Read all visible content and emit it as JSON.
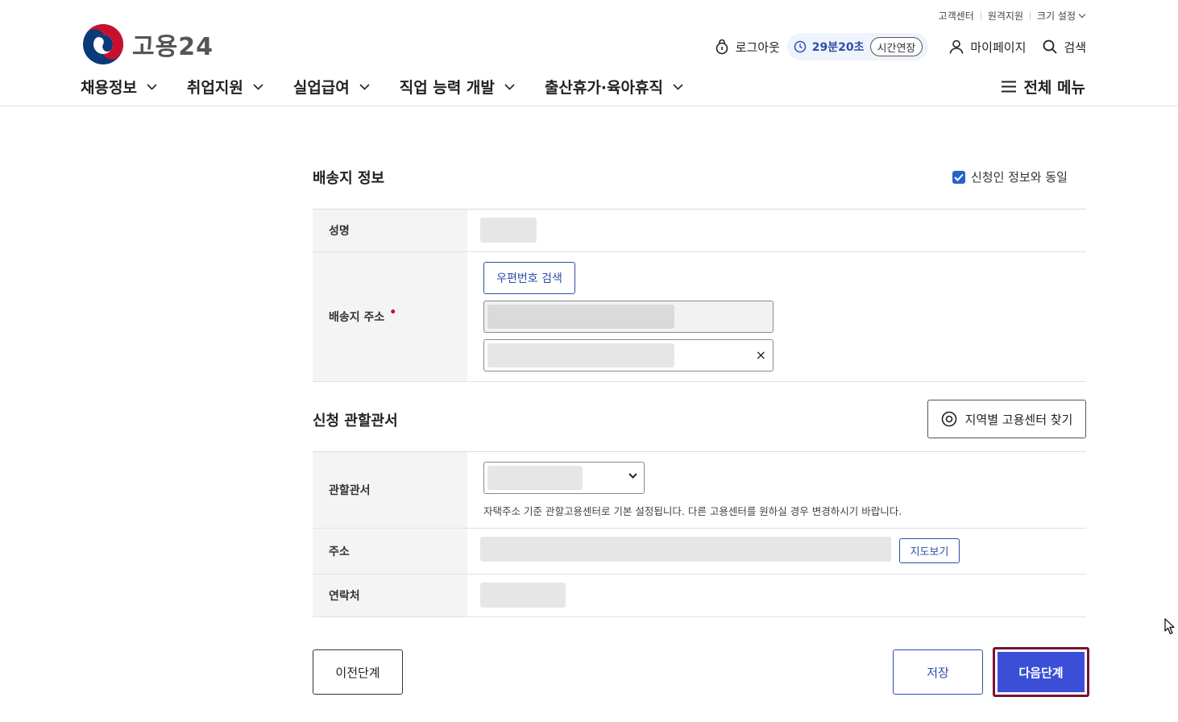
{
  "utility_bar": {
    "items": [
      "고객센터",
      "원격지원",
      "크기 설정"
    ]
  },
  "header": {
    "logo_text": "고용24",
    "logout_label": "로그아웃",
    "timer": "29분20초",
    "extend_label": "시간연장",
    "mypage_label": "마이페이지",
    "search_label": "검색",
    "all_menu_label": "전체 메뉴"
  },
  "nav": {
    "items": [
      {
        "label": "채용정보"
      },
      {
        "label": "취업지원"
      },
      {
        "label": "실업급여"
      },
      {
        "label": "직업 능력 개발"
      },
      {
        "label": "출산휴가·육아휴직"
      }
    ]
  },
  "delivery": {
    "title": "배송지 정보",
    "same_as_applicant_label": "신청인 정보와 동일",
    "same_as_applicant_checked": true,
    "name_label": "성명",
    "address_label": "배송지 주소",
    "required_mark": "•",
    "zip_search_label": "우편번호 검색",
    "clear_icon": "×"
  },
  "office": {
    "title": "신청 관할관서",
    "find_center_label": "지역별 고용센터 찾기",
    "office_label": "관할관서",
    "office_note": "자택주소 기준 관할고용센터로 기본 설정됩니다. 다른 고용센터를 원하실 경우 변경하시기 바랍니다.",
    "address_label": "주소",
    "map_button_label": "지도보기",
    "contact_label": "연락처"
  },
  "footer_buttons": {
    "prev_label": "이전단계",
    "save_label": "저장",
    "next_label": "다음단계"
  },
  "colors": {
    "primary_blue": "#2d4fa8",
    "next_button": "#3a4fd6",
    "focus_ring": "#7a1235",
    "required": "#c8102e"
  }
}
